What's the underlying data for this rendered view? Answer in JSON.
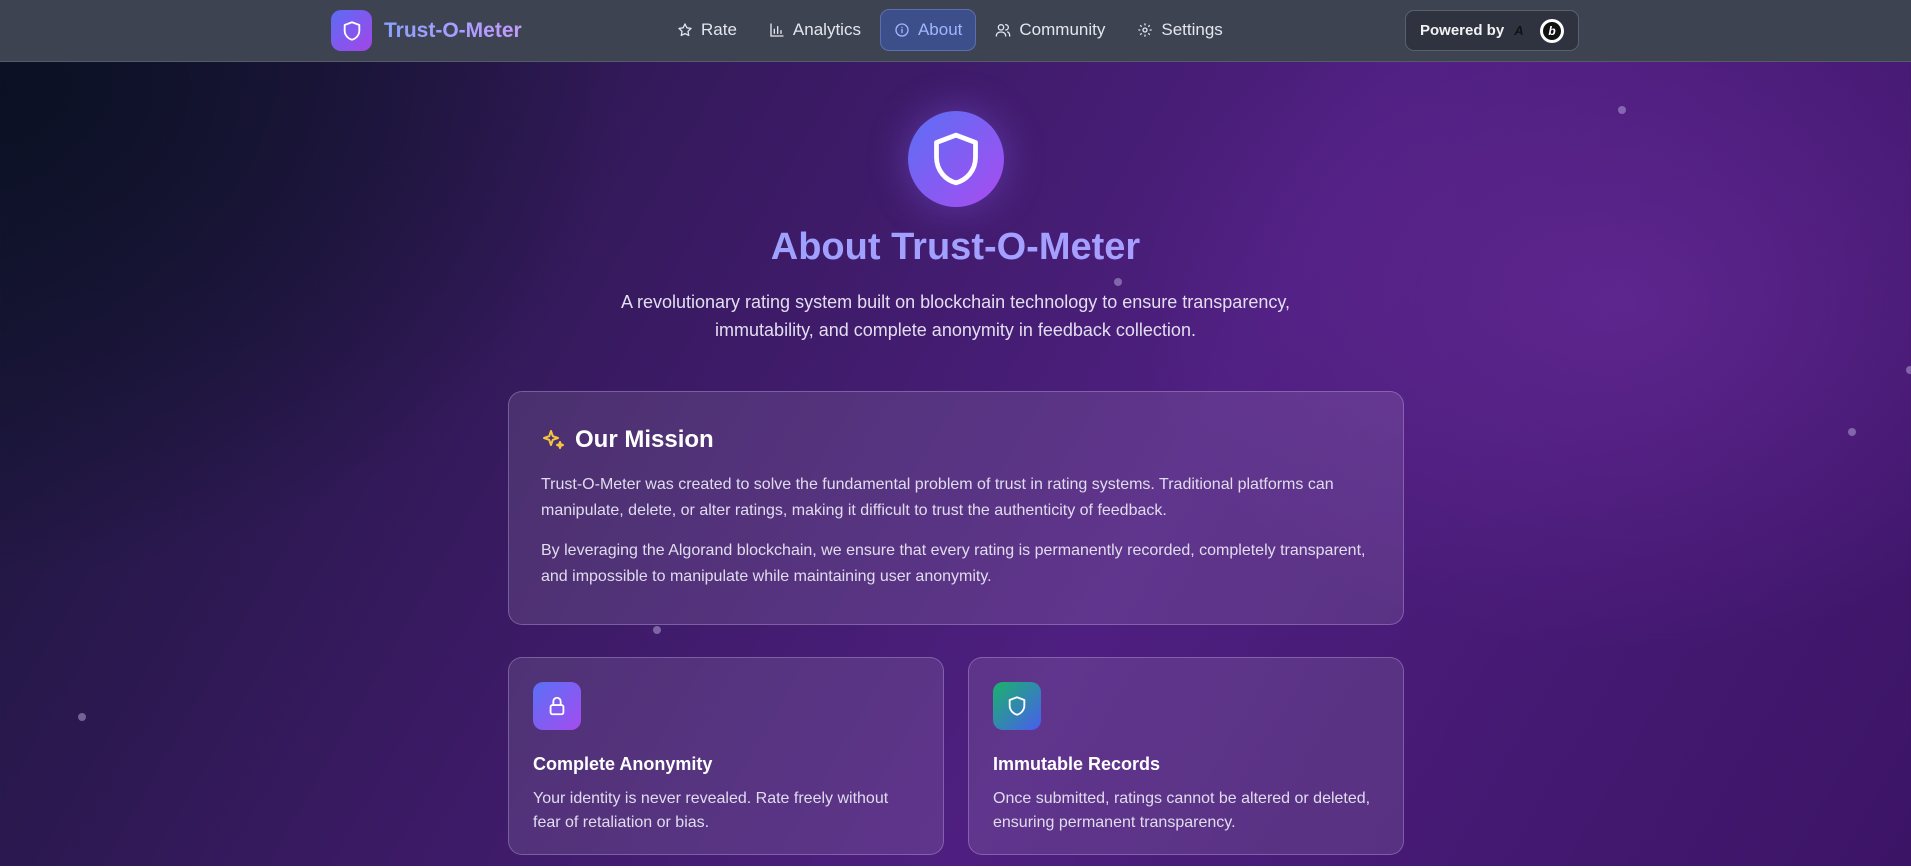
{
  "header": {
    "brand": "Trust-O-Meter",
    "nav": [
      {
        "label": "Rate",
        "icon": "star-icon"
      },
      {
        "label": "Analytics",
        "icon": "bar-chart-icon"
      },
      {
        "label": "About",
        "icon": "info-icon"
      },
      {
        "label": "Community",
        "icon": "users-icon"
      },
      {
        "label": "Settings",
        "icon": "gear-icon"
      }
    ],
    "active": "About",
    "powered_by": "Powered by",
    "algorand_mark": "A",
    "badge_letter": "b"
  },
  "hero": {
    "title": "About Trust-O-Meter",
    "subtitle": "A revolutionary rating system built on blockchain technology to ensure transparency, immutability, and complete anonymity in feedback collection."
  },
  "mission": {
    "title": "Our Mission",
    "paragraph1": "Trust-O-Meter was created to solve the fundamental problem of trust in rating systems. Traditional platforms can manipulate, delete, or alter ratings, making it difficult to trust the authenticity of feedback.",
    "paragraph2": "By leveraging the Algorand blockchain, we ensure that every rating is permanently recorded, completely transparent, and impossible to manipulate while maintaining user anonymity."
  },
  "features": [
    {
      "title": "Complete Anonymity",
      "text": "Your identity is never revealed. Rate freely without fear of retaliation or bias.",
      "icon": "lock-icon"
    },
    {
      "title": "Immutable Records",
      "text": "Once submitted, ratings cannot be altered or deleted, ensuring permanent transparency.",
      "icon": "shield-icon"
    }
  ],
  "colors": {
    "accent": "#8ea6ff",
    "brand_gradient_start": "#5a6ff5",
    "brand_gradient_end": "#a94cf0",
    "mission_icon": "#f5c542"
  }
}
